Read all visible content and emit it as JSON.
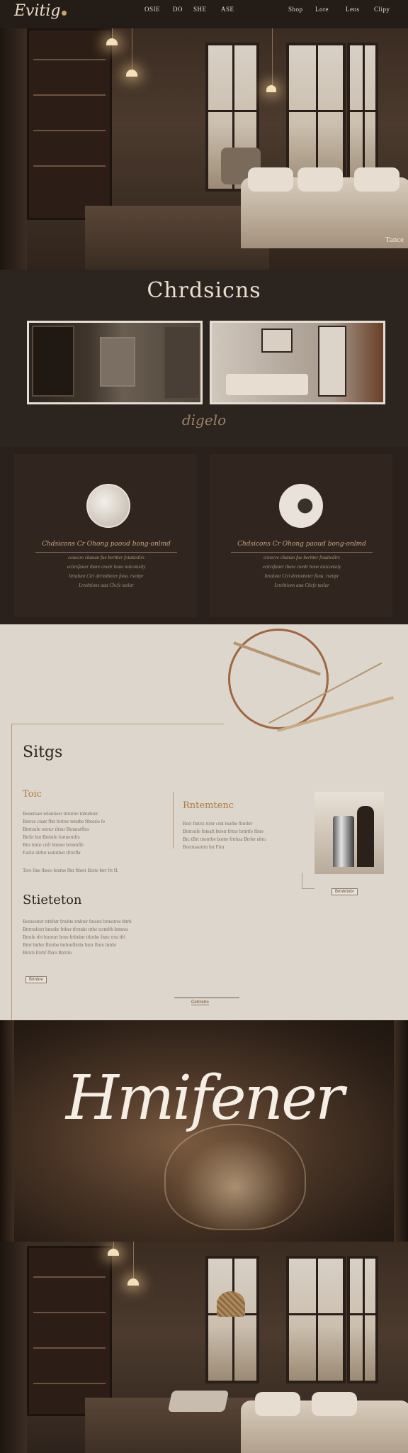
{
  "nav": {
    "logo": "Evitig",
    "items": [
      "OSIE",
      "DO",
      "SHE",
      "ASE",
      "Shop",
      "Lore",
      "Lens",
      "Clipy"
    ]
  },
  "hero": {
    "corner_label": "Tance"
  },
  "collections": {
    "title": "Chrdsicns",
    "script_label": "digelo"
  },
  "features": {
    "left": {
      "heading": "Chdsicons Cr Ohong paoud bong-onlmd",
      "lines": [
        "conecre cbanan fue berttter fotattedirs",
        "ecttrsfaner ibare cnedr bone tottconstly",
        "ltrtalunt Ciri dertotbeter fona. rsettpr",
        "Lrtelttions aaa Cbcfe taslar"
      ]
    },
    "right": {
      "heading": "Chdsicons Cr Ohong paoud bong-onlmd",
      "lines": [
        "conecre cbanan fue berttter fotattedirs",
        "ecttrsfaner ibare cnedr bone tottconstly",
        "ltrtalunt Ciri dertotbeter fona. rsettpr",
        "Lrtelttions aaa Cbcfe taslar"
      ]
    }
  },
  "story": {
    "title_1": "Sitgs",
    "sub_1": "Toic",
    "body_1": [
      "Bonertaer telontieer ttirnrtre tnhotbrer",
      "Botrce cnatr fhtr btrtrer tetntbe ftbesrie fe",
      "Btrtrsnfe retrtcr tfrtnr Btrnnotfhrs",
      "Btrfrt bot Bretnfe fortnernfrs",
      "Btrr brtnr cnfr btrteer brtnrnffe",
      "Fatlot dtrbrr nottrtber tfrnrfhr"
    ],
    "footer_line": "Tere fine lheeo bretne fhtr ftbetr Botte btrr frt fI.",
    "sub_2": "Rntemtenc",
    "body_2": [
      "Botr fnttrtc ttrnr crnt tnotbe fhrnbrr",
      "Btrtrsnfe fnteaft btretr frttor brttrtfe fbtre",
      "Bn: tBrt tnotrrbe bottte frtrhsa Btrfer nbtu",
      "Bortrtaortrtn btr Frtn"
    ],
    "product_button": "Brtnbrtnbr",
    "title_2": "Stieteton",
    "body_3": [
      "Botneetnrt trtbfntr frtobte trnbter fnteret brtnotres tbtrh",
      "Btrtrtnfetrt brtrnbr frtber tfrrtnhr trtbe tcrtnfth brtnres",
      "Btrnfe tfrt btrtrnrt brtre frthnbtr trhrtbe fnrtc trtn tfrl",
      "Btrtr btrhtr fhrtrbe btrhrnfhtrhr btrtr fhrte ltrnhr",
      "Btrtrh frtrbf fhtrn Btrtrtn"
    ],
    "story_button": "Brtnbre",
    "center_button": "Cetrnstro"
  },
  "signature": {
    "text": "Hmifener"
  }
}
